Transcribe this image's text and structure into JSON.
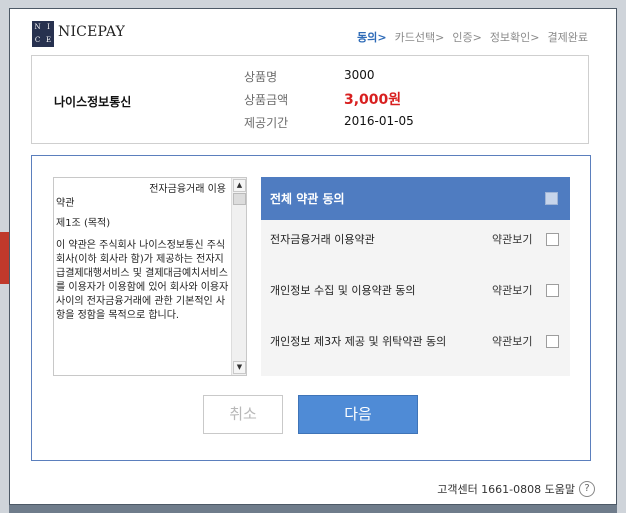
{
  "header": {
    "logo_letters": [
      "N",
      "I",
      "C",
      "E"
    ],
    "brand": "NICEPAY",
    "steps": [
      "동의>",
      "카드선택>",
      "인증>",
      "정보확인>",
      "결제완료"
    ],
    "active_step": 0
  },
  "order": {
    "merchant": "나이스정보통신",
    "product_label": "상품명",
    "product_value": "3000",
    "amount_label": "상품금액",
    "amount_value": "3,000원",
    "period_label": "제공기간",
    "period_value": "2016-01-05"
  },
  "terms": {
    "title_line1": "전자금융거래 이용",
    "title_line2": "약관",
    "section": "제1조 (목적)",
    "body": "이 약관은 주식회사 나이스정보통신 주식회사(이하 회사라 함)가 제공하는 전자지급결제대행서비스 및 결제대금예치서비스를 이용자가 이용함에 있어 회사와 이용자 사이의 전자금융거래에 관한 기본적인 사항을 정함을 목적으로 합니다."
  },
  "agreements": {
    "all_label": "전체 약관 동의",
    "view_label": "약관보기",
    "items": [
      {
        "label": "전자금융거래 이용약관"
      },
      {
        "label": "개인정보 수집 및 이용약관 동의"
      },
      {
        "label": "개인정보 제3자 제공 및 위탁약관 동의"
      }
    ]
  },
  "buttons": {
    "cancel": "취소",
    "next": "다음"
  },
  "footer": {
    "text": "고객센터 1661-0808 도움말",
    "help_icon": "?"
  },
  "colors": {
    "accent": "#4f7cc1",
    "button_primary": "#4f8bd6",
    "price": "#d81f1f",
    "active_step": "#2d6ab7"
  }
}
